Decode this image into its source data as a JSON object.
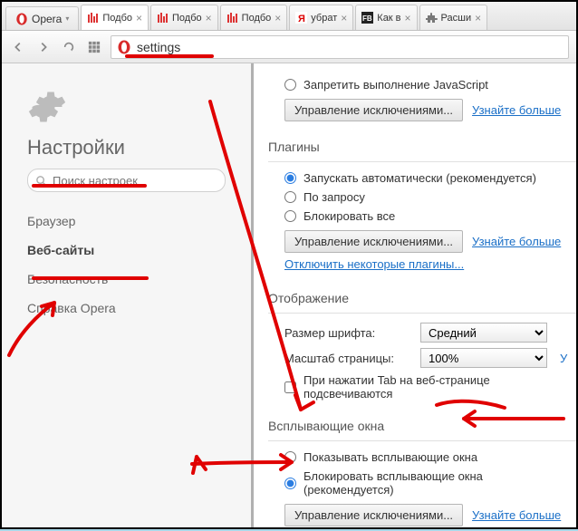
{
  "titlebar": {
    "appname": "Opera",
    "dropdown": "▾"
  },
  "tabs": [
    {
      "label": "Подбо",
      "icon": "bars"
    },
    {
      "label": "Подбо",
      "icon": "bars"
    },
    {
      "label": "Подбо",
      "icon": "bars"
    },
    {
      "label": "убрат",
      "icon": "ya"
    },
    {
      "label": "Как в",
      "icon": "fb"
    },
    {
      "label": "Расши",
      "icon": "puzzle"
    }
  ],
  "address": {
    "value": "settings"
  },
  "sidebar": {
    "title": "Настройки",
    "search_placeholder": "Поиск настроек",
    "items": [
      {
        "label": "Браузер"
      },
      {
        "label": "Веб-сайты"
      },
      {
        "label": "Безопасность"
      },
      {
        "label": "Справка Opera"
      }
    ]
  },
  "js": {
    "deny_label": "Запретить выполнение JavaScript",
    "manage_btn": "Управление исключениями...",
    "learn": "Узнайте больше"
  },
  "plugins": {
    "title": "Плагины",
    "auto": "Запускать автоматически (рекомендуется)",
    "ondemand": "По запросу",
    "block": "Блокировать все",
    "manage_btn": "Управление исключениями...",
    "learn": "Узнайте больше",
    "disable": "Отключить некоторые плагины..."
  },
  "display": {
    "title": "Отображение",
    "fontsize_label": "Размер шрифта:",
    "fontsize_value": "Средний",
    "zoom_label": "Масштаб страницы:",
    "zoom_value": "100%",
    "tabhl_label": "При нажатии Tab на веб-странице подсвечиваются",
    "learn_arrow": "У"
  },
  "popups": {
    "title": "Всплывающие окна",
    "show": "Показывать всплывающие окна",
    "block": "Блокировать всплывающие окна (рекомендуется)",
    "manage_btn": "Управление исключениями...",
    "learn": "Узнайте больше"
  }
}
